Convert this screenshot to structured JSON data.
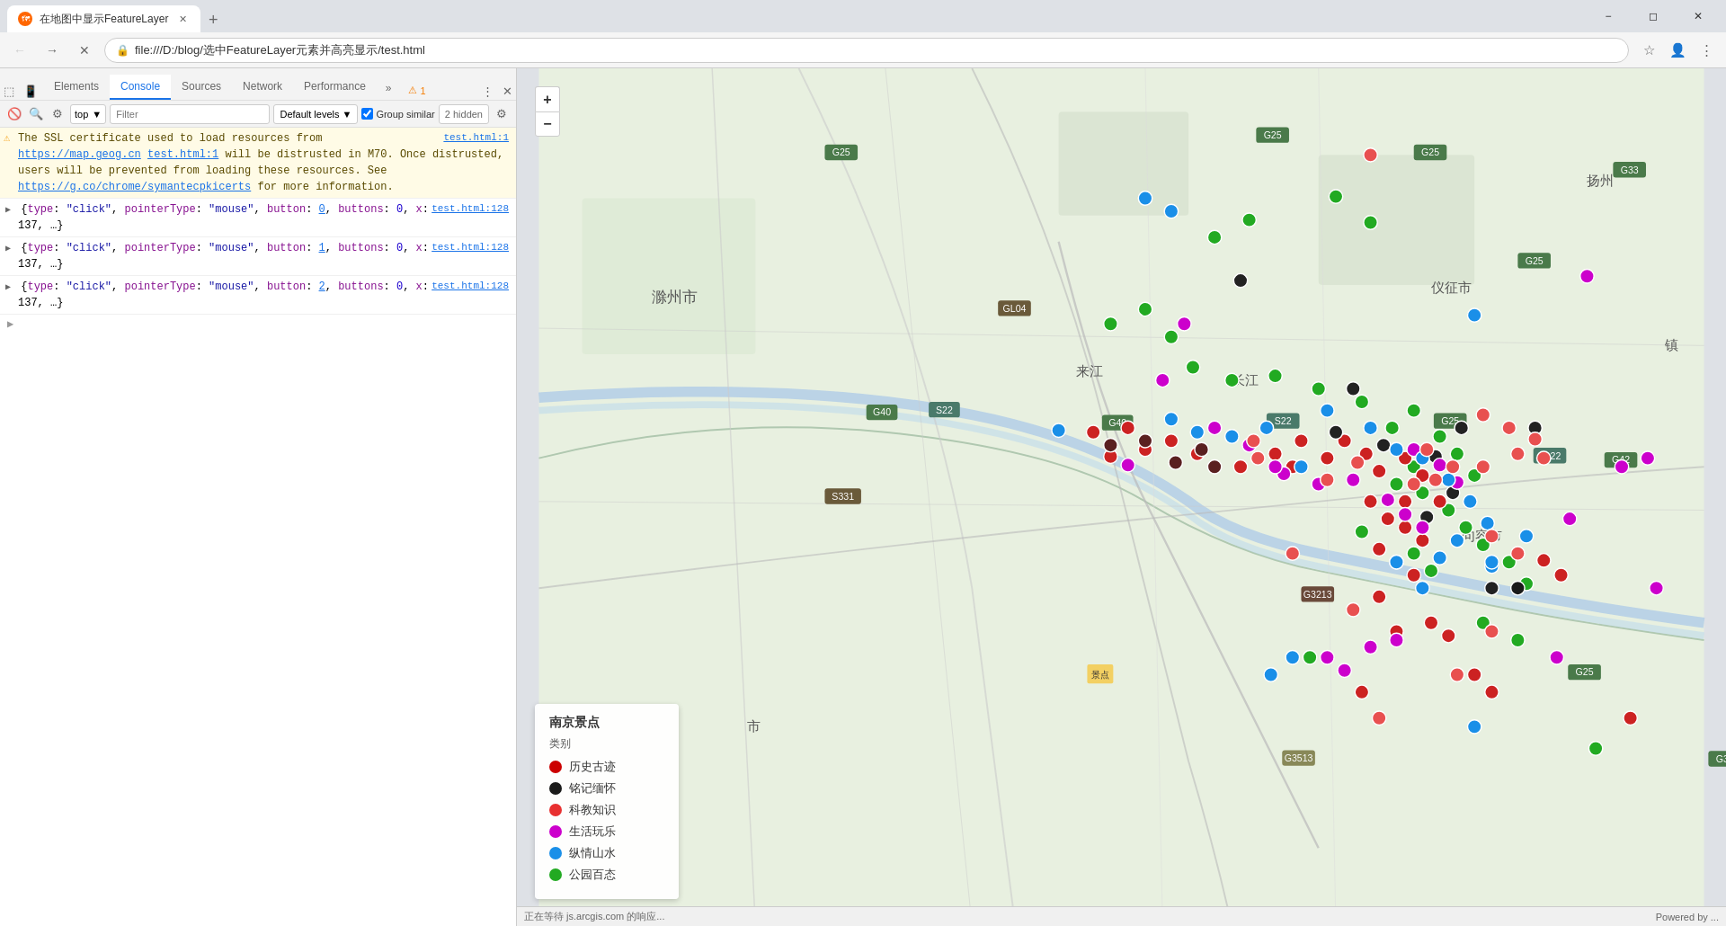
{
  "window": {
    "title": "在地图中显示FeatureLayer",
    "url": "file:///D:/blog/选中FeatureLayer元素并高亮显示/test.html"
  },
  "tabs": [
    {
      "id": "tab1",
      "title": "在地图中显示FeatureLayer",
      "active": true
    }
  ],
  "devtools": {
    "tabs": [
      "Elements",
      "Console",
      "Sources",
      "Network",
      "Performance"
    ],
    "active_tab": "Console",
    "more_label": "»",
    "warning_count": "1",
    "toolbar": {
      "context_label": "top",
      "filter_placeholder": "Filter",
      "default_levels_label": "Default levels",
      "group_similar_label": "Group similar",
      "hidden_count": "2 hidden"
    },
    "console_messages": [
      {
        "type": "warning",
        "source_link": "test.html:1",
        "text_parts": [
          "The SSL certificate used to load resources from ",
          "https://map.geog.cn",
          " ",
          "test.html:1",
          " will be distrusted in M70. Once distrusted, users will be prevented from loading these resources. See ",
          "https://g.co/chrome/symantecpkicerts",
          " for more information."
        ]
      },
      {
        "type": "log",
        "source_link": "test.html:128",
        "text": "{type: \"click\", pointerType: \"mouse\", button: 0, buttons: 0, x: 137, …}",
        "button_val": "0"
      },
      {
        "type": "log",
        "source_link": "test.html:128",
        "text": "{type: \"click\", pointerType: \"mouse\", button: 1, buttons: 0, x: 137, …}",
        "button_val": "1"
      },
      {
        "type": "log",
        "source_link": "test.html:128",
        "text": "{type: \"click\", pointerType: \"mouse\", button: 2, buttons: 0, x: 137, …}",
        "button_val": "2"
      }
    ]
  },
  "map": {
    "title": "南京景点",
    "legend_title": "南京景点",
    "legend_subtitle": "类别",
    "legend_items": [
      {
        "label": "历史古迹",
        "color": "#cc0000"
      },
      {
        "label": "铭记缅怀",
        "color": "#1a1a1a"
      },
      {
        "label": "科教知识",
        "color": "#e83030"
      },
      {
        "label": "生活玩乐",
        "color": "#cc00cc"
      },
      {
        "label": "纵情山水",
        "color": "#1a8fe8"
      },
      {
        "label": "公园百态",
        "color": "#22aa22"
      }
    ],
    "zoom_in": "+",
    "zoom_out": "−"
  },
  "status_bar": {
    "text": "正在等待 js.arcgis.com 的响应...",
    "powered_by": "Powered by ..."
  }
}
